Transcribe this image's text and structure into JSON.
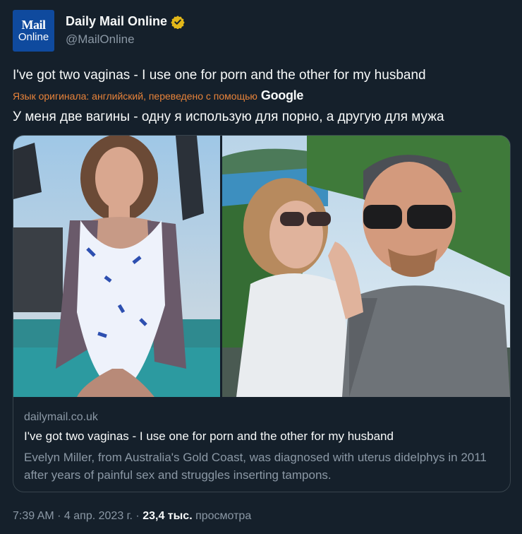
{
  "author": {
    "display_name": "Daily Mail Online",
    "handle": "@MailOnline",
    "avatar_line1": "Mail",
    "avatar_line2": "Online",
    "verified_icon": "verified-gold-badge"
  },
  "tweet": {
    "text_original": "I've got two vaginas - I use one for porn and the other for my husband",
    "translation_note": "Язык оригинала: английский, переведено с помощью",
    "translation_provider": "Google",
    "text_translated": "У меня две вагины - одну я использую для порно, а другую для мужа"
  },
  "card": {
    "domain": "dailymail.co.uk",
    "title": "I've got two vaginas - I use one for porn and the other for my husband",
    "description": "Evelyn Miller, from Australia's Gold Coast, was diagnosed with uterus didelphys in 2011 after years of painful sex and struggles inserting tampons."
  },
  "meta": {
    "time": "7:39 AM",
    "separator": " · ",
    "date": "4 апр. 2023 г.",
    "views_count": "23,4 тыс.",
    "views_label": "просмотра"
  },
  "colors": {
    "background": "#15202b",
    "text_primary": "#f7f9f9",
    "text_secondary": "#8b98a5",
    "translation_accent": "#e8833a",
    "verified_gold": "#e2b719",
    "avatar_blue": "#0f4a9e",
    "border": "#38444d"
  }
}
